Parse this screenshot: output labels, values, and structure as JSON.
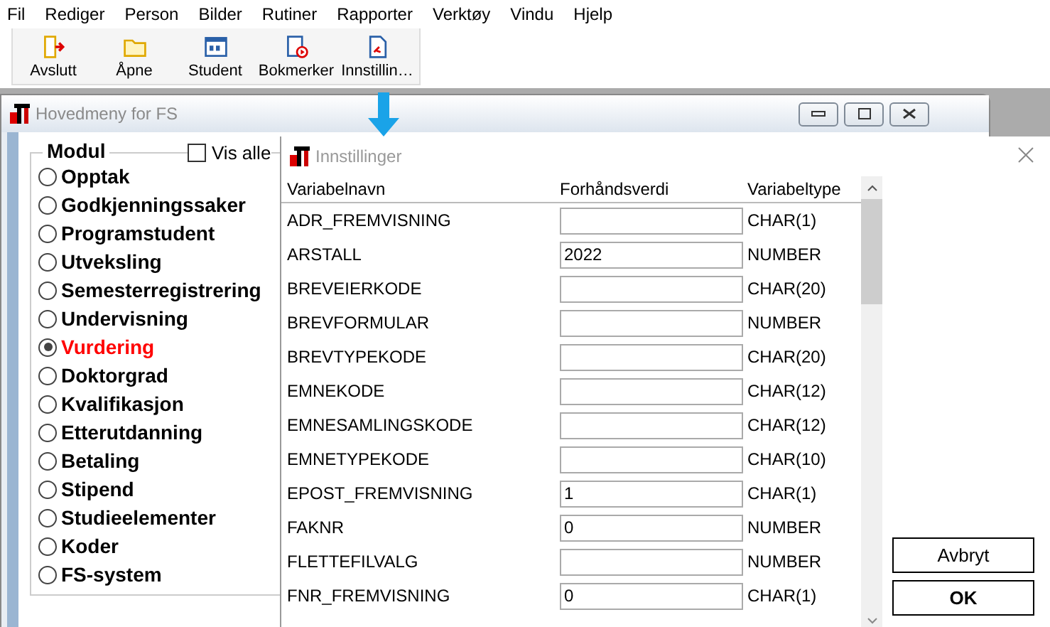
{
  "menu_bar": [
    "Fil",
    "Rediger",
    "Person",
    "Bilder",
    "Rutiner",
    "Rapporter",
    "Verktøy",
    "Vindu",
    "Hjelp"
  ],
  "toolbar": [
    {
      "kind": "exit",
      "label": "Avslutt"
    },
    {
      "kind": "folder",
      "label": "Åpne"
    },
    {
      "kind": "student",
      "label": "Student"
    },
    {
      "kind": "bookmark",
      "label": "Bokmerker"
    },
    {
      "kind": "settings",
      "label": "Innstillin…"
    }
  ],
  "main_window": {
    "title": "Hovedmeny for FS",
    "group_title": "Modul",
    "show_all": {
      "label": "Vis alle",
      "checked": false
    },
    "modules": [
      {
        "label": "Opptak",
        "selected": false
      },
      {
        "label": "Godkjenningssaker",
        "selected": false
      },
      {
        "label": "Programstudent",
        "selected": false
      },
      {
        "label": "Utveksling",
        "selected": false
      },
      {
        "label": "Semesterregistrering",
        "selected": false
      },
      {
        "label": "Undervisning",
        "selected": false
      },
      {
        "label": "Vurdering",
        "selected": true
      },
      {
        "label": "Doktorgrad",
        "selected": false
      },
      {
        "label": "Kvalifikasjon",
        "selected": false
      },
      {
        "label": "Etterutdanning",
        "selected": false
      },
      {
        "label": "Betaling",
        "selected": false
      },
      {
        "label": "Stipend",
        "selected": false
      },
      {
        "label": "Studieelementer",
        "selected": false
      },
      {
        "label": "Koder",
        "selected": false
      },
      {
        "label": "FS-system",
        "selected": false
      }
    ]
  },
  "dialog": {
    "title": "Innstillinger",
    "columns": [
      "Variabelnavn",
      "Forhåndsverdi",
      "Variabeltype"
    ],
    "rows": [
      {
        "name": "ADR_FREMVISNING",
        "value": "",
        "type": "CHAR(1)"
      },
      {
        "name": "ARSTALL",
        "value": "2022",
        "type": "NUMBER"
      },
      {
        "name": "BREVEIERKODE",
        "value": "",
        "type": "CHAR(20)"
      },
      {
        "name": "BREVFORMULAR",
        "value": "",
        "type": "NUMBER"
      },
      {
        "name": "BREVTYPEKODE",
        "value": "",
        "type": "CHAR(20)"
      },
      {
        "name": "EMNEKODE",
        "value": "",
        "type": "CHAR(12)"
      },
      {
        "name": "EMNESAMLINGSKODE",
        "value": "",
        "type": "CHAR(12)"
      },
      {
        "name": "EMNETYPEKODE",
        "value": "",
        "type": "CHAR(10)"
      },
      {
        "name": "EPOST_FREMVISNING",
        "value": "1",
        "type": "CHAR(1)"
      },
      {
        "name": "FAKNR",
        "value": "0",
        "type": "NUMBER"
      },
      {
        "name": "FLETTEFILVALG",
        "value": "",
        "type": "NUMBER"
      },
      {
        "name": "FNR_FREMVISNING",
        "value": "0",
        "type": "CHAR(1)"
      }
    ],
    "buttons": [
      "Avbryt",
      "OK"
    ]
  }
}
